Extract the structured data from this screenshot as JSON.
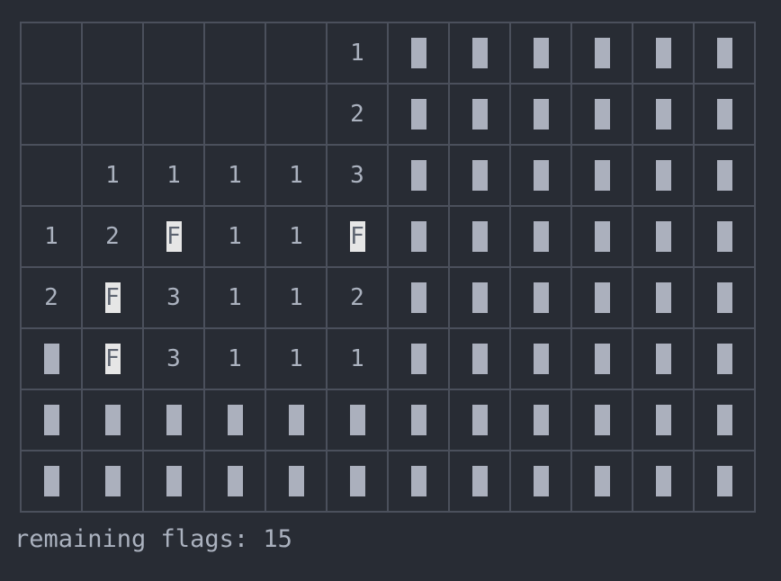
{
  "board": {
    "rows": [
      [
        "",
        "",
        "",
        "",
        "",
        "1",
        "#",
        "#",
        "#",
        "#",
        "#",
        "#"
      ],
      [
        "",
        "",
        "",
        "",
        "",
        "2",
        "#",
        "#",
        "#",
        "#",
        "#",
        "#"
      ],
      [
        "",
        "1",
        "1",
        "1",
        "1",
        "3",
        "#",
        "#",
        "#",
        "#",
        "#",
        "#"
      ],
      [
        "1",
        "2",
        "F",
        "1",
        "1",
        "F",
        "#",
        "#",
        "#",
        "#",
        "#",
        "#"
      ],
      [
        "2",
        "F",
        "3",
        "1",
        "1",
        "2",
        "#",
        "#",
        "#",
        "#",
        "#",
        "#"
      ],
      [
        "#",
        "F",
        "3",
        "1",
        "1",
        "1",
        "#",
        "#",
        "#",
        "#",
        "#",
        "#"
      ],
      [
        "#",
        "#",
        "#",
        "#",
        "#",
        "#",
        "#",
        "#",
        "#",
        "#",
        "#",
        "#"
      ],
      [
        "#",
        "#",
        "#",
        "#",
        "#",
        "#",
        "#",
        "#",
        "#",
        "#",
        "#",
        "#"
      ]
    ],
    "flag_glyph": "F"
  },
  "status": {
    "text": "remaining flags: 15"
  }
}
